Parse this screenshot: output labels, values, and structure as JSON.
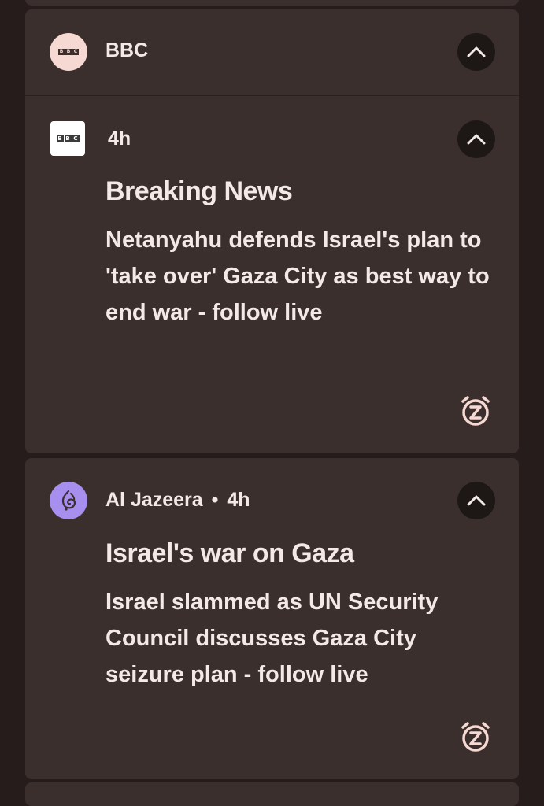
{
  "notifications": [
    {
      "app_name": "BBC",
      "time": "4h",
      "title": "Breaking News",
      "body": "Netanyahu defends Israel's plan to 'take over' Gaza City as best way to end war - follow live",
      "icon": "bbc-logo",
      "actions": [
        "collapse-chevron-icon",
        "snooze-icon"
      ]
    },
    {
      "app_name": "Al Jazeera",
      "separator": "•",
      "time": "4h",
      "title": "Israel's war on Gaza",
      "body": "Israel slammed as UN Security Council discusses Gaza City seizure plan - follow live",
      "icon": "al-jazeera-logo",
      "actions": [
        "collapse-chevron-icon",
        "snooze-icon"
      ]
    }
  ],
  "logo_text": [
    "B",
    "B",
    "C"
  ],
  "colors": {
    "background": "#251c1b",
    "card": "#3b2f2e",
    "text": "#f3e9e7",
    "accent": "#f7d9d3",
    "al_jazeera_avatar": "#a78ff0",
    "button": "#1d1716"
  }
}
